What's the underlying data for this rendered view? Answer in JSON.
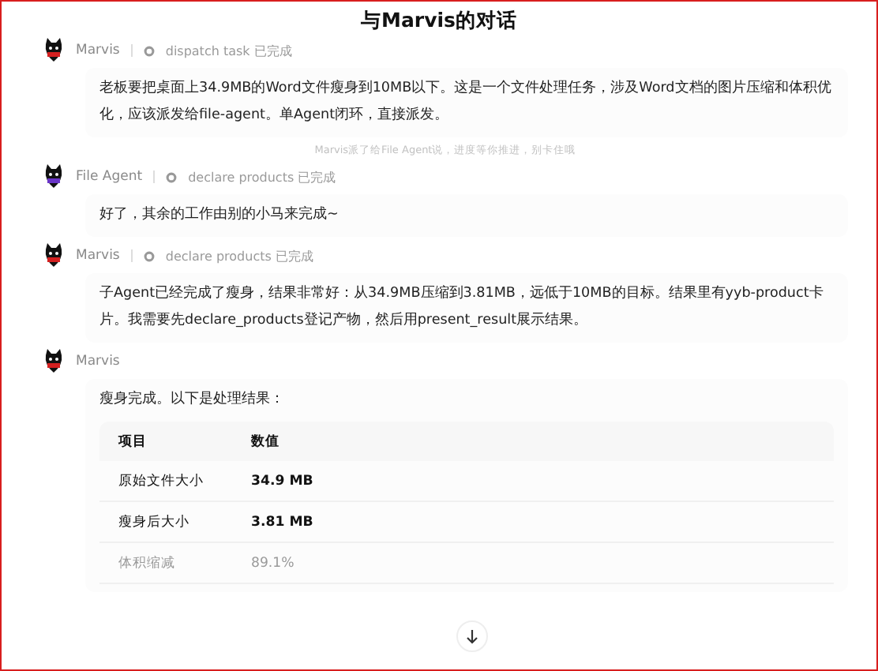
{
  "title": "与Marvis的对话",
  "items": [
    {
      "kind": "message",
      "author": "Marvis",
      "color": "#d42020",
      "tool": "dispatch task",
      "status": "已完成",
      "paragraph": "老板要把桌面上34.9MB的Word文件瘦身到10MB以下。这是一个文件处理任务，涉及Word文档的图片压缩和体积优化，应该派发给file-agent。单Agent闭环，直接派发。"
    },
    {
      "kind": "note",
      "text": "Marvis派了给File Agent说，进度等你推进，别卡住哦"
    },
    {
      "kind": "message",
      "author": "File Agent",
      "color": "#6a35c8",
      "tool": "declare products",
      "status": "已完成",
      "paragraph": "好了，其余的工作由别的小马来完成~"
    },
    {
      "kind": "message",
      "author": "Marvis",
      "color": "#d42020",
      "tool": "declare products",
      "status": "已完成",
      "paragraph": "子Agent已经完成了瘦身，结果非常好：从34.9MB压缩到3.81MB，远低于10MB的目标。结果里有yyb-product卡片。我需要先declare_products登记产物，然后用present_result展示结果。"
    },
    {
      "kind": "message",
      "author": "Marvis",
      "color": "#d42020",
      "paragraph": "瘦身完成。以下是处理结果：",
      "table": {
        "columns": [
          "项目",
          "数值"
        ],
        "rows": [
          [
            "原始文件大小",
            "34.9 MB"
          ],
          [
            "瘦身后大小",
            "3.81 MB"
          ],
          [
            "体积缩减",
            "89.1%"
          ]
        ]
      }
    }
  ]
}
